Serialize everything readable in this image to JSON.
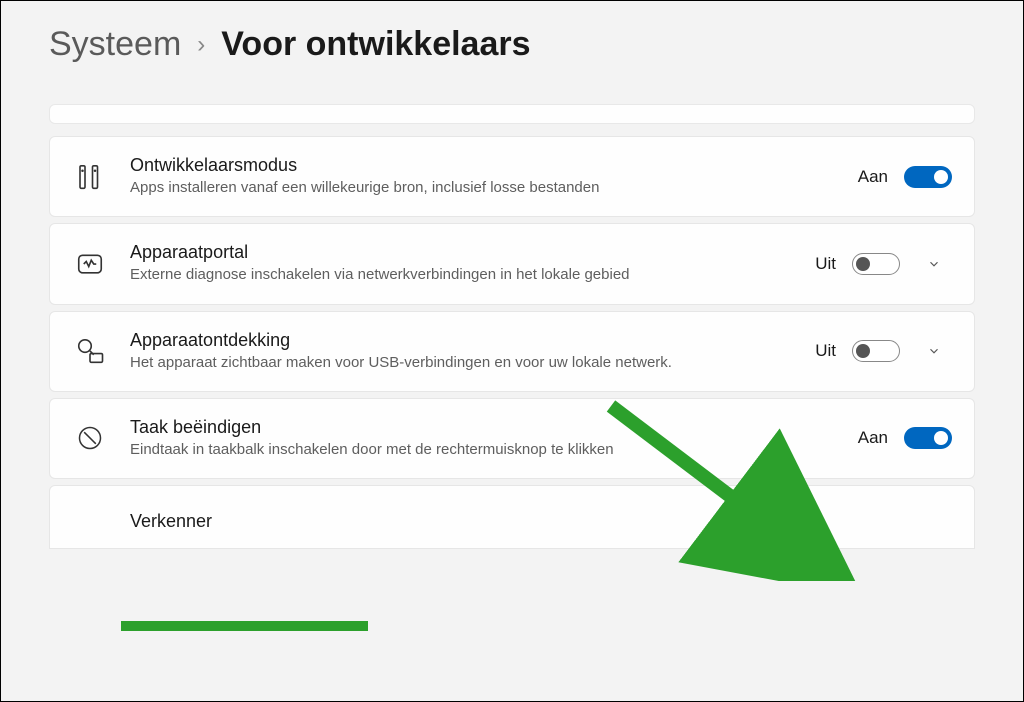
{
  "breadcrumb": {
    "parent": "Systeem",
    "current": "Voor ontwikkelaars"
  },
  "labels": {
    "on": "Aan",
    "off": "Uit"
  },
  "settings": [
    {
      "icon": "developer-tools-icon",
      "title": "Ontwikkelaarsmodus",
      "desc": "Apps installeren vanaf een willekeurige bron, inclusief losse bestanden",
      "state": "on",
      "expandable": false
    },
    {
      "icon": "device-portal-icon",
      "title": "Apparaatportal",
      "desc": "Externe diagnose inschakelen via netwerkverbindingen in het lokale gebied",
      "state": "off",
      "expandable": true
    },
    {
      "icon": "device-discovery-icon",
      "title": "Apparaatontdekking",
      "desc": "Het apparaat zichtbaar maken voor USB-verbindingen en voor uw lokale netwerk.",
      "state": "off",
      "expandable": true
    },
    {
      "icon": "end-task-icon",
      "title": "Taak beëindigen",
      "desc": "Eindtaak in taakbalk inschakelen door met de rechtermuisknop te klikken",
      "state": "on",
      "expandable": false
    }
  ],
  "partial": {
    "title": "Verkenner"
  },
  "annotations": {
    "arrow_color": "#2ca02c",
    "underline_color": "#2ca02c"
  }
}
